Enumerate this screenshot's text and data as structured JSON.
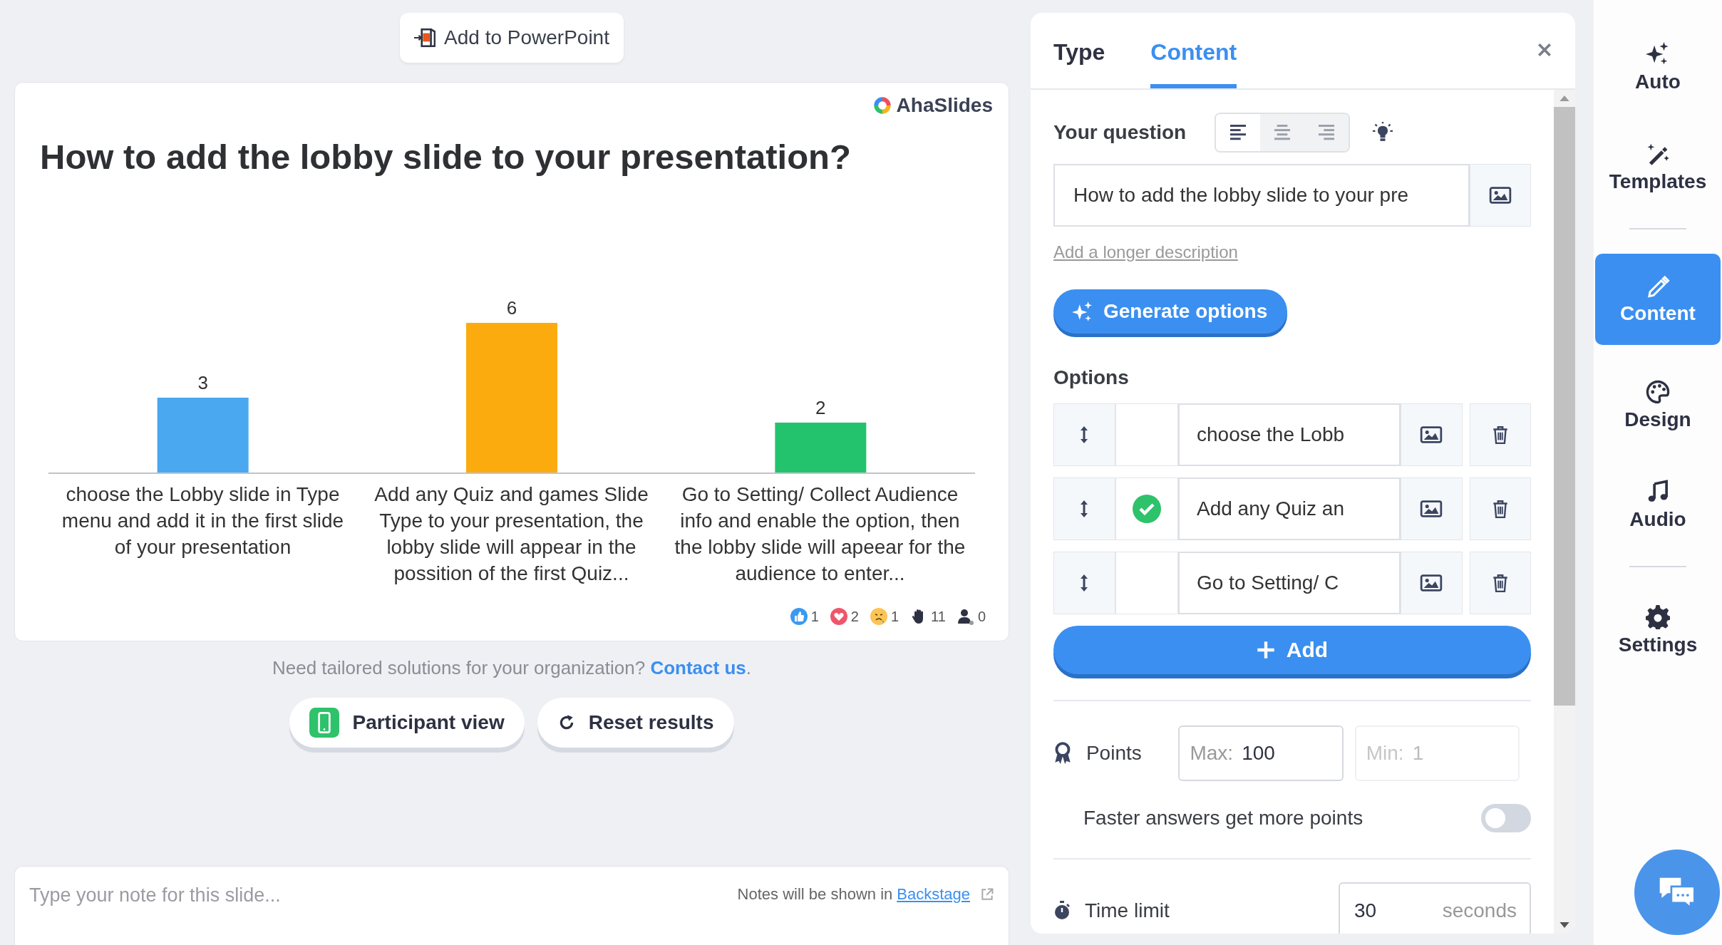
{
  "toolbar": {
    "add_to_powerpoint": "Add to PowerPoint"
  },
  "slide": {
    "brand": "AhaSlides",
    "title": "How to add the lobby slide to your presentation?",
    "chart_data": {
      "type": "bar",
      "categories": [
        "choose the Lobby slide in Type menu and add it in the first slide of your presentation",
        "Add any Quiz and games Slide Type to your presentation, the lobby slide will appear in the possition of the first Quiz...",
        "Go to Setting/ Collect Audience info and enable the option, then the lobby slide will apeear for the audience to enter..."
      ],
      "values": [
        3,
        6,
        2
      ],
      "colors": [
        "#4aa8f0",
        "#fcab0f",
        "#23c36e"
      ],
      "data_labels": true
    },
    "reactions": [
      {
        "kind": "like",
        "count": "1"
      },
      {
        "kind": "heart",
        "count": "2"
      },
      {
        "kind": "sad",
        "count": "1"
      },
      {
        "kind": "hand",
        "count": "11"
      },
      {
        "kind": "person",
        "count": "0"
      }
    ]
  },
  "footer": {
    "text": "Need tailored solutions for your organization?",
    "link": "Contact us",
    "after": "."
  },
  "buttons": [
    {
      "kind": "participant",
      "label": "Participant view"
    },
    {
      "kind": "reset",
      "label": "Reset results"
    }
  ],
  "notes": {
    "placeholder": "Type your note for this slide...",
    "hint": "Notes will be shown in",
    "link": "Backstage"
  },
  "panel": {
    "tabs": [
      {
        "label": "Type",
        "selected": false
      },
      {
        "label": "Content",
        "selected": true
      }
    ],
    "question_label": "Your question",
    "align": [
      {
        "kind": "left",
        "selected": true
      },
      {
        "kind": "center",
        "selected": false
      },
      {
        "kind": "right",
        "selected": false
      }
    ],
    "question_value": "How to add the lobby slide to your pre",
    "description_link": "Add a longer description",
    "generate": "Generate options",
    "options_label": "Options",
    "options": [
      {
        "text": "choose the Lobb",
        "correct": false
      },
      {
        "text": "Add any Quiz an",
        "correct": true
      },
      {
        "text": "Go to Setting/ C",
        "correct": false
      }
    ],
    "add": "Add",
    "points_label": "Points",
    "max": {
      "prefix": "Max:",
      "value": "100"
    },
    "min": {
      "prefix": "Min:",
      "value": "1",
      "disabled": true
    },
    "faster": {
      "label": "Faster answers get more points",
      "on": false
    },
    "time_limit": {
      "label": "Time limit",
      "value": "30",
      "unit": "seconds"
    }
  },
  "sidebar": [
    [
      {
        "kind": "auto",
        "label": "Auto",
        "selected": false
      },
      {
        "kind": "templates",
        "label": "Templates",
        "selected": false
      }
    ],
    [
      {
        "kind": "content",
        "label": "Content",
        "selected": true
      },
      {
        "kind": "design",
        "label": "Design",
        "selected": false
      },
      {
        "kind": "audio",
        "label": "Audio",
        "selected": false
      }
    ],
    [
      {
        "kind": "settings",
        "label": "Settings",
        "selected": false
      }
    ]
  ]
}
